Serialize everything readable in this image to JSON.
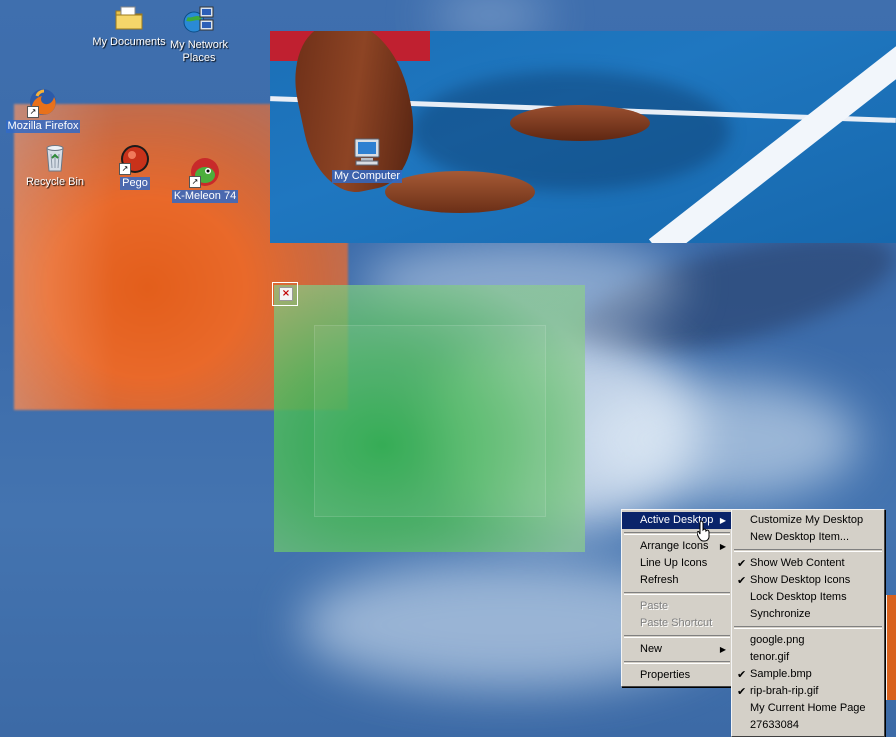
{
  "desktop": {
    "icons": [
      {
        "name": "My Documents",
        "icon": "folder-documents-icon"
      },
      {
        "name": "My Network Places",
        "name_lines": [
          "My Network",
          "Places"
        ],
        "icon": "network-places-icon"
      },
      {
        "name": "Mozilla Firefox",
        "icon": "firefox-icon"
      },
      {
        "name": "Recycle Bin",
        "icon": "recycle-bin-icon"
      },
      {
        "name": "Pego",
        "icon": "pego-icon"
      },
      {
        "name": "K-Meleon 74",
        "icon": "k-meleon-icon"
      },
      {
        "name": "My Computer",
        "icon": "computer-icon"
      }
    ],
    "close_glyph": "×"
  },
  "context_menu": {
    "items": [
      {
        "label": "Active Desktop",
        "submenu": true,
        "highlighted": true
      },
      {
        "separator": true
      },
      {
        "label": "Arrange Icons",
        "submenu": true
      },
      {
        "label": "Line Up Icons"
      },
      {
        "label": "Refresh"
      },
      {
        "separator": true
      },
      {
        "label": "Paste",
        "disabled": true
      },
      {
        "label": "Paste Shortcut",
        "disabled": true
      },
      {
        "separator": true
      },
      {
        "label": "New",
        "submenu": true
      },
      {
        "separator": true
      },
      {
        "label": "Properties"
      }
    ]
  },
  "active_desktop_submenu": {
    "items": [
      {
        "label": "Customize My Desktop"
      },
      {
        "label": "New Desktop Item..."
      },
      {
        "separator": true
      },
      {
        "label": "Show Web Content",
        "checked": true
      },
      {
        "label": "Show Desktop Icons",
        "checked": true
      },
      {
        "label": "Lock Desktop Items"
      },
      {
        "label": "Synchronize"
      },
      {
        "separator": true
      },
      {
        "label": "google.png"
      },
      {
        "label": "tenor.gif"
      },
      {
        "label": "Sample.bmp",
        "checked": true
      },
      {
        "label": "rip-brah-rip.gif",
        "checked": true
      },
      {
        "label": "My Current Home Page"
      },
      {
        "label": "27633084"
      }
    ]
  },
  "glyphs": {
    "submenu_arrow": "▶",
    "check": "✔"
  },
  "colors": {
    "menu_face": "#d4d0c8",
    "menu_highlight": "#0a246a",
    "desktop_blue": "#3a6aa9"
  }
}
